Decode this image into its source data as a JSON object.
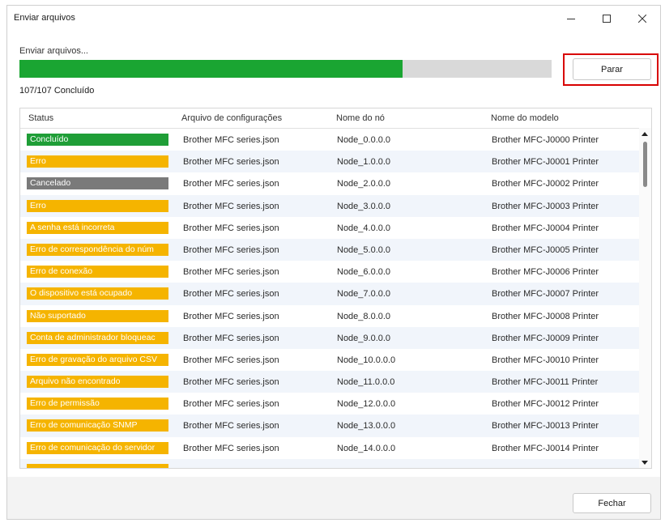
{
  "window": {
    "title": "Enviar arquivos"
  },
  "status_text": "Enviar arquivos...",
  "progress": {
    "fraction": 0.72,
    "color": "#1aa532"
  },
  "completed_text": "107/107 Concluído",
  "buttons": {
    "stop": "Parar",
    "close": "Fechar"
  },
  "table": {
    "columns": [
      "Status",
      "Arquivo de configurações",
      "Nome do nó",
      "Nome do modelo"
    ],
    "rows": [
      {
        "status": "Concluído",
        "color": "#1f9e37",
        "file": "Brother MFC series.json",
        "node": "Node_0.0.0.0",
        "model": "Brother MFC-J0000 Printer"
      },
      {
        "status": "Erro",
        "color": "#f5b400",
        "file": "Brother MFC series.json",
        "node": "Node_1.0.0.0",
        "model": "Brother MFC-J0001 Printer"
      },
      {
        "status": "Cancelado",
        "color": "#7a7a7a",
        "file": "Brother MFC series.json",
        "node": "Node_2.0.0.0",
        "model": "Brother MFC-J0002 Printer"
      },
      {
        "status": "Erro",
        "color": "#f5b400",
        "file": "Brother MFC series.json",
        "node": "Node_3.0.0.0",
        "model": "Brother MFC-J0003 Printer"
      },
      {
        "status": "A senha está incorreta",
        "color": "#f5b400",
        "file": "Brother MFC series.json",
        "node": "Node_4.0.0.0",
        "model": "Brother MFC-J0004 Printer"
      },
      {
        "status": "Erro de correspondência do núm",
        "color": "#f5b400",
        "file": "Brother MFC series.json",
        "node": "Node_5.0.0.0",
        "model": "Brother MFC-J0005 Printer"
      },
      {
        "status": "Erro de conexão",
        "color": "#f5b400",
        "file": "Brother MFC series.json",
        "node": "Node_6.0.0.0",
        "model": "Brother MFC-J0006 Printer"
      },
      {
        "status": "O dispositivo está ocupado",
        "color": "#f5b400",
        "file": "Brother MFC series.json",
        "node": "Node_7.0.0.0",
        "model": "Brother MFC-J0007 Printer"
      },
      {
        "status": "Não suportado",
        "color": "#f5b400",
        "file": "Brother MFC series.json",
        "node": "Node_8.0.0.0",
        "model": "Brother MFC-J0008 Printer"
      },
      {
        "status": "Conta de administrador bloqueac",
        "color": "#f5b400",
        "file": "Brother MFC series.json",
        "node": "Node_9.0.0.0",
        "model": "Brother MFC-J0009 Printer"
      },
      {
        "status": "Erro de gravação do arquivo CSV",
        "color": "#f5b400",
        "file": "Brother MFC series.json",
        "node": "Node_10.0.0.0",
        "model": "Brother MFC-J0010 Printer"
      },
      {
        "status": "Arquivo não encontrado",
        "color": "#f5b400",
        "file": "Brother MFC series.json",
        "node": "Node_11.0.0.0",
        "model": "Brother MFC-J0011 Printer"
      },
      {
        "status": "Erro de permissão",
        "color": "#f5b400",
        "file": "Brother MFC series.json",
        "node": "Node_12.0.0.0",
        "model": "Brother MFC-J0012 Printer"
      },
      {
        "status": "Erro de comunicação SNMP",
        "color": "#f5b400",
        "file": "Brother MFC series.json",
        "node": "Node_13.0.0.0",
        "model": "Brother MFC-J0013 Printer"
      },
      {
        "status": "Erro de comunicação do servidor",
        "color": "#f5b400",
        "file": "Brother MFC series.json",
        "node": "Node_14.0.0.0",
        "model": "Brother MFC-J0014 Printer"
      },
      {
        "status": "",
        "color": "#f5b400",
        "file": "",
        "node": "",
        "model": ""
      }
    ]
  }
}
